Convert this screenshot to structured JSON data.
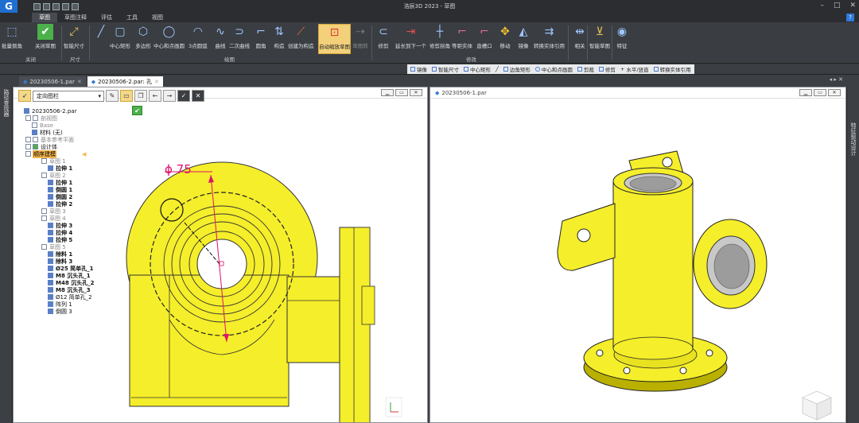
{
  "window": {
    "title": "浩辰3D 2023 - 草图",
    "logo": "G"
  },
  "menu": {
    "tabs": [
      "草图",
      "草图注释",
      "评估",
      "工具",
      "视图"
    ],
    "active": "草图",
    "help": "?"
  },
  "ribbon": {
    "groups": [
      {
        "label": "关闭",
        "buttons": [
          "批量倒角",
          "关闭草图"
        ]
      },
      {
        "label": "尺寸",
        "buttons": [
          "智能尺寸"
        ]
      },
      {
        "label": "绘图",
        "buttons": [
          "中心矩形",
          "多边形",
          "中心和点画圆",
          "3点圆弧",
          "曲线",
          "二次曲线",
          "圆角",
          "构造",
          "创建为构造",
          "自动缩放草图",
          "草图转"
        ]
      },
      {
        "label": "修改",
        "buttons": [
          "修剪",
          "延长到下一个",
          "修剪拐角",
          "等距实体",
          "直槽口",
          "移动",
          "镜像",
          "转换实体引用"
        ]
      },
      {
        "buttons": [
          "相关",
          "智能草图",
          "特征"
        ]
      }
    ],
    "highlighted": "自动缩放草图"
  },
  "command_bar": {
    "items": [
      "镜像",
      "智能尺寸",
      "中心矩形",
      "",
      "边角矩形",
      "中心和点画圆",
      "剪裁",
      "修剪",
      "水平/竖直",
      "转换实体引用"
    ]
  },
  "doc_tabs": [
    {
      "label": "20230506-1.par",
      "active": false
    },
    {
      "label": "20230506-2.par: 孔",
      "active": true
    }
  ],
  "left_strip": {
    "label": "路径查找器"
  },
  "right_strip": {
    "label": "特征驱动设计"
  },
  "viewports": {
    "left": {
      "title": ""
    },
    "right": {
      "title": "20230506-1.par"
    }
  },
  "pathfinder": {
    "filter": "定向图栏",
    "tree": [
      {
        "label": "20230506-2.par",
        "level": 0,
        "style": "box"
      },
      {
        "label": "剖视图",
        "level": 1,
        "style": "dim"
      },
      {
        "label": "Base",
        "level": 1,
        "style": "dim"
      },
      {
        "label": "材料 (无)",
        "level": 1,
        "style": ""
      },
      {
        "label": "基本参考平面",
        "level": 1,
        "style": "dim"
      },
      {
        "label": "设计体",
        "level": 1,
        "style": ""
      },
      {
        "label": "顺序建模",
        "level": 1,
        "style": "sel"
      },
      {
        "label": "草图 1",
        "level": 2,
        "style": "dim"
      },
      {
        "label": "拉伸 1",
        "level": 2,
        "style": "bold"
      },
      {
        "label": "草图 2",
        "level": 2,
        "style": "dim"
      },
      {
        "label": "拉伸 1",
        "level": 2,
        "style": "bold"
      },
      {
        "label": "倒圆 1",
        "level": 2,
        "style": "bold"
      },
      {
        "label": "倒圆 2",
        "level": 2,
        "style": "bold"
      },
      {
        "label": "拉伸 2",
        "level": 2,
        "style": "bold"
      },
      {
        "label": "草图 3",
        "level": 2,
        "style": "dim"
      },
      {
        "label": "草图 4",
        "level": 2,
        "style": "dim"
      },
      {
        "label": "拉伸 3",
        "level": 2,
        "style": "bold"
      },
      {
        "label": "拉伸 4",
        "level": 2,
        "style": "bold"
      },
      {
        "label": "拉伸 5",
        "level": 2,
        "style": "bold"
      },
      {
        "label": "草图 5",
        "level": 2,
        "style": "dim"
      },
      {
        "label": "除料 1",
        "level": 2,
        "style": "bold"
      },
      {
        "label": "除料 3",
        "level": 2,
        "style": "bold"
      },
      {
        "label": "Ø25 简单孔_1",
        "level": 2,
        "style": "bold"
      },
      {
        "label": "M8 沉头孔_1",
        "level": 2,
        "style": "bold"
      },
      {
        "label": "M48 沉头孔_2",
        "level": 2,
        "style": "bold"
      },
      {
        "label": "M8 沉头孔_3",
        "level": 2,
        "style": "bold"
      },
      {
        "label": "Ø12 简单孔_2",
        "level": 2,
        "style": ""
      },
      {
        "label": "阵列 1",
        "level": 2,
        "style": ""
      },
      {
        "label": "倒圆 3",
        "level": 2,
        "style": ""
      }
    ]
  },
  "sketch": {
    "dimension": "ϕ 75"
  },
  "colors": {
    "part": "#f5ee2a",
    "part_dark": "#b9b000",
    "dimension": "#e0126b",
    "highlight": "#f3b64f"
  }
}
